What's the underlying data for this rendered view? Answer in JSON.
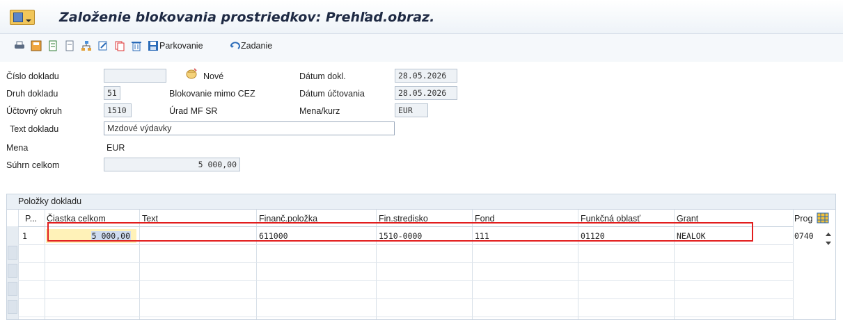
{
  "window": {
    "title": "Založenie blokovania prostriedkov: Prehľad.obraz."
  },
  "toolbar": {
    "icons": [
      "print-icon",
      "save-icon",
      "document-icon",
      "document-copy-icon",
      "hierarchy-icon",
      "edit-icon",
      "copy-icon",
      "delete-icon"
    ],
    "park_label": "Parkovanie",
    "entry_label": "Zadanie"
  },
  "form": {
    "doc_number_label": "Číslo dokladu",
    "doc_number_value": "",
    "new_label": "Nové",
    "doc_type_label": "Druh dokladu",
    "doc_type_value": "51",
    "doc_type_desc": "Blokovanie mimo CEZ",
    "company_label": "Účtovný okruh",
    "company_value": "1510",
    "company_desc": "Úrad MF SR",
    "doc_date_label": "Dátum dokl.",
    "doc_date_value": "28.05.2026",
    "post_date_label": "Dátum účtovania",
    "post_date_value": "28.05.2026",
    "currency_rate_label": "Mena/kurz",
    "currency_rate_value": "EUR",
    "doc_text_label": "Text dokladu",
    "doc_text_value": "Mzdové výdavky",
    "currency_label": "Mena",
    "currency_value": "EUR",
    "total_label": "Súhrn celkom",
    "total_value": "5 000,00"
  },
  "items": {
    "group_title": "Položky dokladu",
    "columns": [
      "P...",
      "Čiastka celkom",
      "Text",
      "Finanč.položka",
      "Fin.stredisko",
      "Fond",
      "Funkčná oblasť",
      "Grant",
      "Prog"
    ],
    "rows": [
      {
        "pos": "1",
        "amount": "5 000,00",
        "text": "",
        "fin_item": "611000",
        "fund_center": "1510-0000",
        "fund": "111",
        "func_area": "01120",
        "grant": "NEALOK",
        "prog": "0740"
      }
    ]
  },
  "colors": {
    "highlight_border": "#e21d1d",
    "amount_cell_bg": "#fff2b8"
  }
}
